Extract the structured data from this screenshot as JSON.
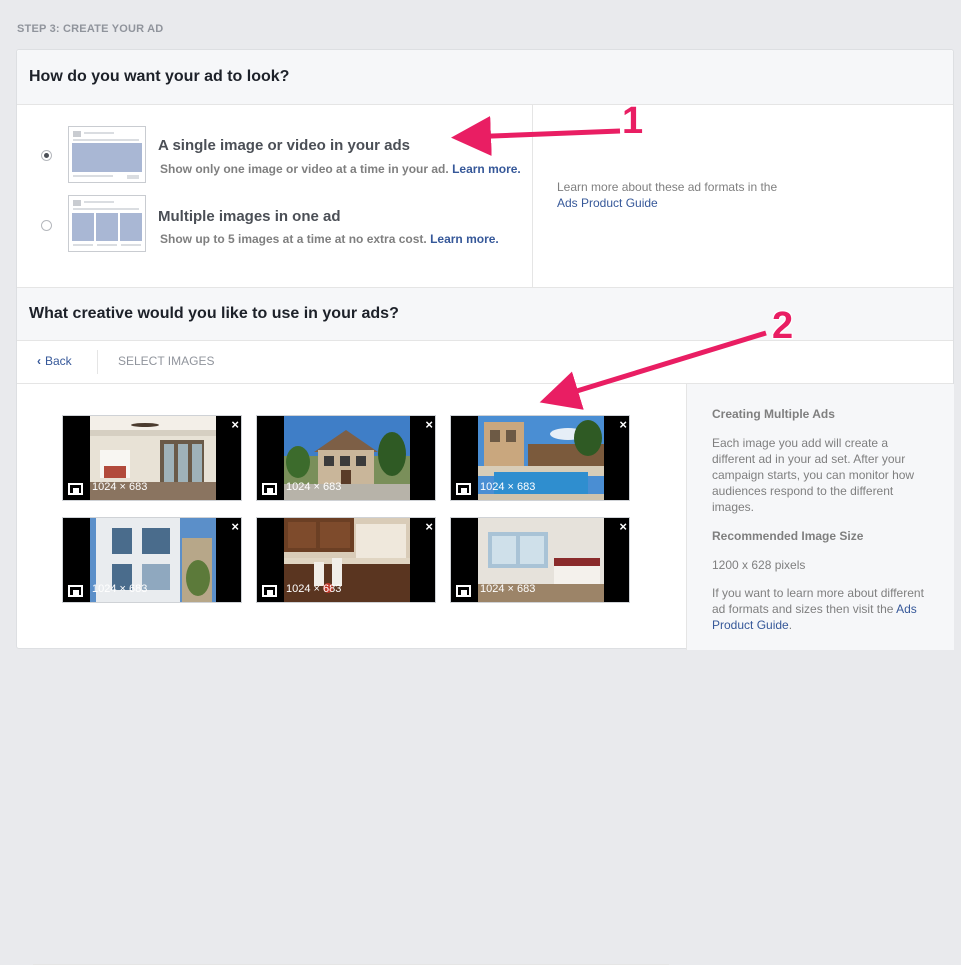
{
  "step_label": "STEP 3: CREATE YOUR AD",
  "format_section": {
    "title": "How do you want your ad to look?",
    "options": [
      {
        "title": "A single image or video in your ads",
        "desc": "Show only one image or video at a time in your ad.",
        "link": "Learn more.",
        "selected": true
      },
      {
        "title": "Multiple images in one ad",
        "desc": "Show up to 5 images at a time at no extra cost.",
        "link": "Learn more.",
        "selected": false
      }
    ],
    "learn_text": "Learn more about these ad formats in the",
    "learn_link": "Ads Product Guide"
  },
  "creative_section": {
    "title": "What creative would you like to use in your ads?",
    "back_label": "Back",
    "select_label": "SELECT IMAGES",
    "images": [
      {
        "dim": "1024 × 683",
        "close": "×"
      },
      {
        "dim": "1024 × 683",
        "close": "×"
      },
      {
        "dim": "1024 × 683",
        "close": "×"
      },
      {
        "dim": "1024 × 683",
        "close": "×"
      },
      {
        "dim": "1024 × 683",
        "close": "×"
      },
      {
        "dim": "1024 × 683",
        "close": "×"
      }
    ]
  },
  "sidebar": {
    "heading1": "Creating Multiple Ads",
    "para1": "Each image you add will create a different ad in your ad set. After your campaign starts, you can monitor how audiences respond to the different images.",
    "heading2": "Recommended Image Size",
    "size": "1200 x 628 pixels",
    "para3": "If you want to learn more about different ad formats and sizes then visit the",
    "para3_link": "Ads Product Guide",
    "para3_end": "."
  },
  "annotations": {
    "n1": "1",
    "n2": "2",
    "color": "#e91e63"
  }
}
